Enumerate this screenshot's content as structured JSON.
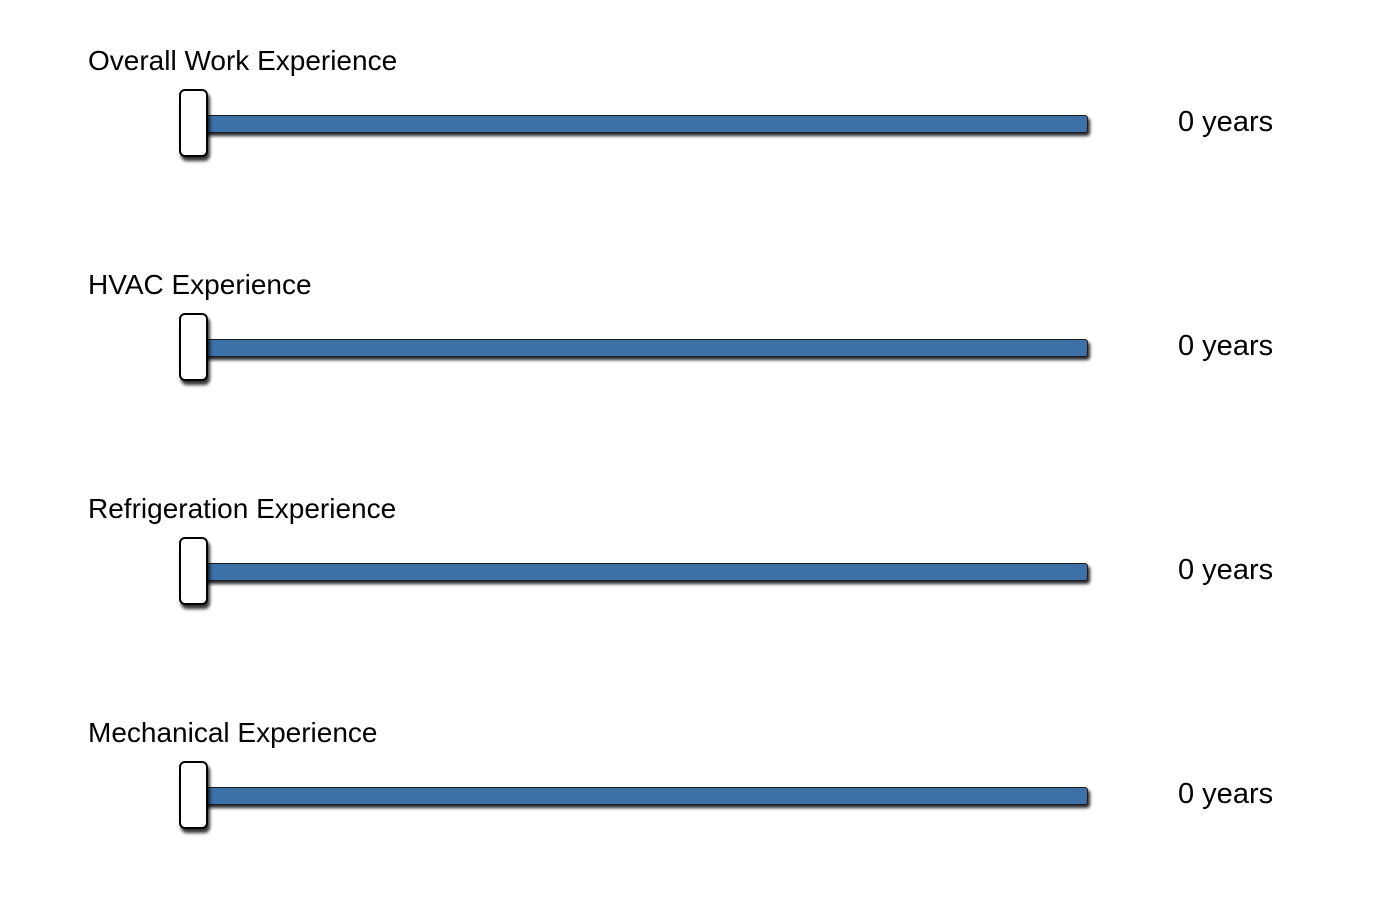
{
  "theme": {
    "track_color": "#3d72a8",
    "thumb_color": "#ffffff"
  },
  "sliders": [
    {
      "label": "Overall Work Experience",
      "value": 0,
      "min": 0,
      "unit": "years",
      "value_text": "0 years"
    },
    {
      "label": "HVAC Experience",
      "value": 0,
      "min": 0,
      "unit": "years",
      "value_text": "0 years"
    },
    {
      "label": "Refrigeration Experience",
      "value": 0,
      "min": 0,
      "unit": "years",
      "value_text": "0 years"
    },
    {
      "label": "Mechanical Experience",
      "value": 0,
      "min": 0,
      "unit": "years",
      "value_text": "0 years"
    }
  ]
}
